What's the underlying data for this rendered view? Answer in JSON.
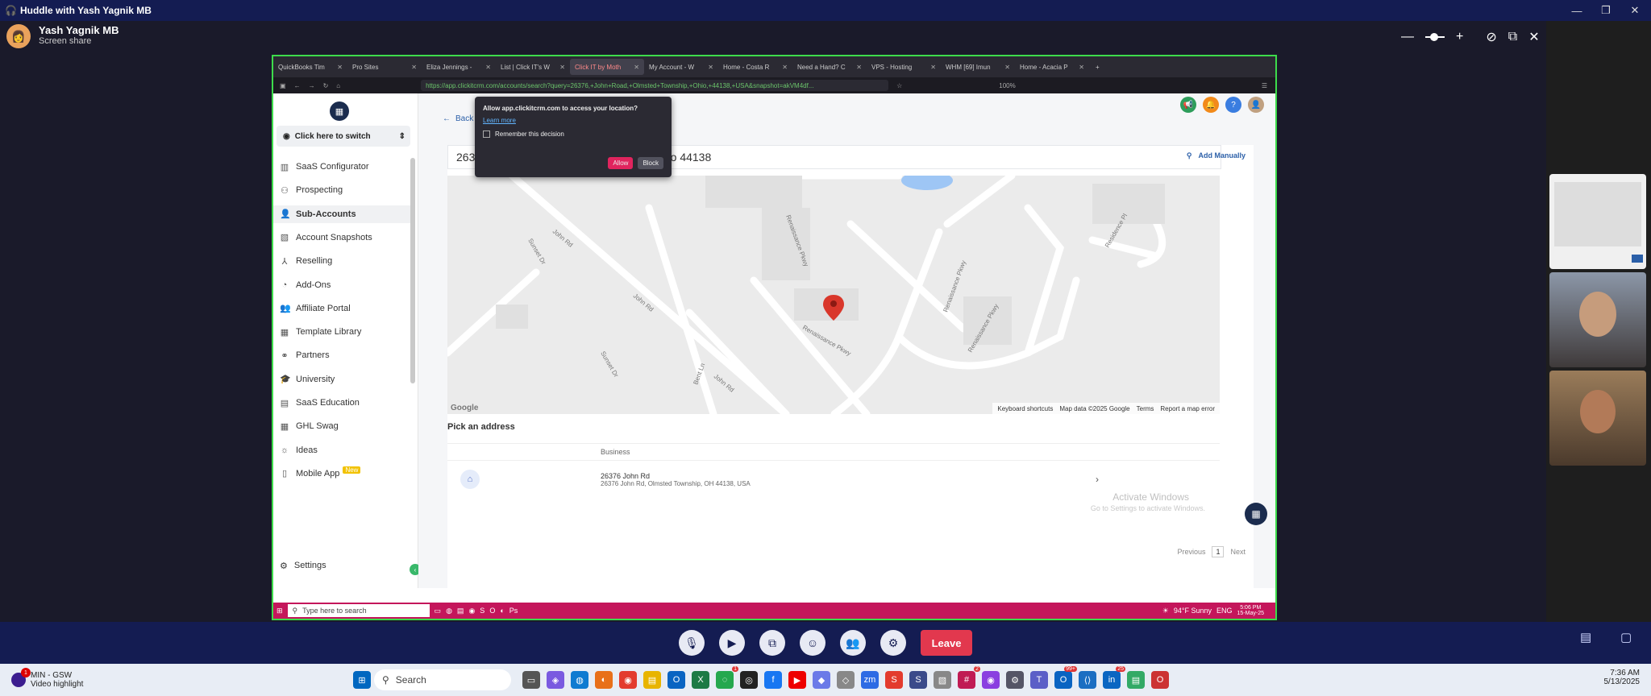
{
  "app": {
    "title": "Huddle with Yash Yagnik MB"
  },
  "presenter": {
    "name": "Yash Yagnik MB",
    "status": "Screen share"
  },
  "browser": {
    "tabs": [
      "QuickBooks Tim",
      "Pro Sites",
      "Eliza Jennings -",
      "List | Click IT's W",
      "Click IT by Moth",
      "My Account - W",
      "Home - Costa R",
      "Need a Hand? C",
      "VPS - Hosting",
      "WHM [69] Imun",
      "Home - Acacia P"
    ],
    "active_tab": 4,
    "url": "https://app.clickitcrm.com/accounts/search?query=26376,+John+Road,+Olmsted+Township,+Ohio,+44138,+USA&snapshot=akVM4df...",
    "zoom": "100%"
  },
  "location_popup": {
    "question": "Allow app.clickitcrm.com to access your location?",
    "learn_more": "Learn more",
    "remember": "Remember this decision",
    "allow": "Allow",
    "block": "Block"
  },
  "sidebar": {
    "switch_label": "Click here to switch",
    "items": [
      {
        "label": "SaaS Configurator",
        "icon": "chart-icon"
      },
      {
        "label": "Prospecting",
        "icon": "user-search-icon"
      },
      {
        "label": "Sub-Accounts",
        "icon": "user-icon"
      },
      {
        "label": "Account Snapshots",
        "icon": "image-icon"
      },
      {
        "label": "Reselling",
        "icon": "hierarchy-icon"
      },
      {
        "label": "Add-Ons",
        "icon": "addon-icon"
      },
      {
        "label": "Affiliate Portal",
        "icon": "users-icon"
      },
      {
        "label": "Template Library",
        "icon": "boxes-icon"
      },
      {
        "label": "Partners",
        "icon": "handshake-icon"
      },
      {
        "label": "University",
        "icon": "graduation-icon"
      },
      {
        "label": "SaaS Education",
        "icon": "book-icon"
      },
      {
        "label": "GHL Swag",
        "icon": "store-icon"
      },
      {
        "label": "Ideas",
        "icon": "bulb-icon"
      },
      {
        "label": "Mobile App",
        "icon": "mobile-icon",
        "badge": "New"
      }
    ],
    "selected": "Sub-Accounts",
    "settings": "Settings"
  },
  "main": {
    "back": "Back",
    "address_input": "26376 John Road | Olmsted Township, Ohio 44138",
    "add_manually": "Add Manually",
    "map": {
      "streets": [
        "John Rd",
        "John Rd",
        "John Rd",
        "Sunset Dr",
        "Sunset Dr",
        "Renaissance Pkwy",
        "Renaissance Pkwy",
        "Renaissance Pkwy",
        "Renaissance Pkwy",
        "Bent Ln",
        "Residence Pl"
      ],
      "footer": [
        "Keyboard shortcuts",
        "Map data ©2025 Google",
        "Terms",
        "Report a map error"
      ],
      "logo": "Google"
    },
    "pick_title": "Pick an address",
    "table_header": "Business",
    "result": {
      "line1": "26376 John Rd",
      "line2": "26376 John Rd, Olmsted Township, OH 44138, USA"
    },
    "pager": {
      "prev": "Previous",
      "page": "1",
      "next": "Next"
    },
    "watermark": {
      "line1": "Activate Windows",
      "line2": "Go to Settings to activate Windows."
    }
  },
  "inner_taskbar": {
    "search": "Type here to search",
    "weather": "94°F Sunny",
    "lang": "ENG",
    "time": "5:06 PM",
    "date": "15-May-25"
  },
  "controls": {
    "leave": "Leave"
  },
  "notification": {
    "title": "MIN - GSW",
    "sub": "Video highlight",
    "count": "1"
  },
  "taskbar": {
    "search": "Search",
    "time": "7:36 AM",
    "date": "5/13/2025",
    "badges": [
      "1",
      "2",
      "99+",
      "25"
    ]
  }
}
